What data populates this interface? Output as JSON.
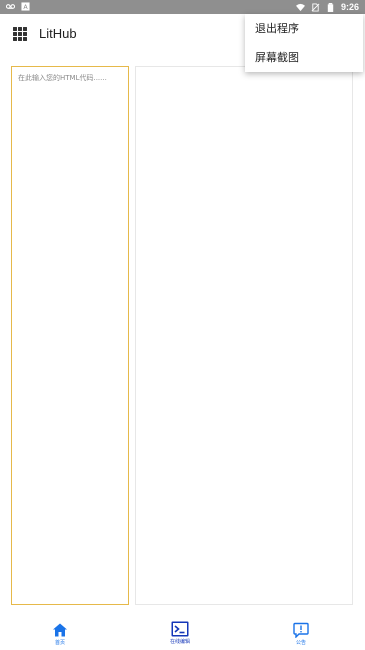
{
  "status_bar": {
    "time": "9:26",
    "left_icons": [
      "voicemail-icon",
      "notification-a-icon"
    ],
    "right_icons": [
      "wifi-icon",
      "no-sim-icon",
      "battery-icon"
    ]
  },
  "app_bar": {
    "title": "LitHub",
    "menu_icon": "apps-grid-icon"
  },
  "overflow_menu": {
    "items": [
      {
        "label": "退出程序"
      },
      {
        "label": "屏幕截图"
      }
    ]
  },
  "editor": {
    "placeholder": "在此输入您的HTML代码......",
    "value": ""
  },
  "bottom_nav": {
    "items": [
      {
        "label": "首页",
        "icon": "home-icon",
        "color": "#1a73e8"
      },
      {
        "label": "在线编辑",
        "icon": "terminal-icon",
        "color": "#1436b8",
        "selected": true
      },
      {
        "label": "公告",
        "icon": "announcement-icon",
        "color": "#1a73e8"
      }
    ]
  },
  "colors": {
    "status_bar": "#8f8f8f",
    "editor_border": "#e6b94a",
    "accent_blue": "#1a73e8",
    "selected_dark_blue": "#1436b8"
  }
}
